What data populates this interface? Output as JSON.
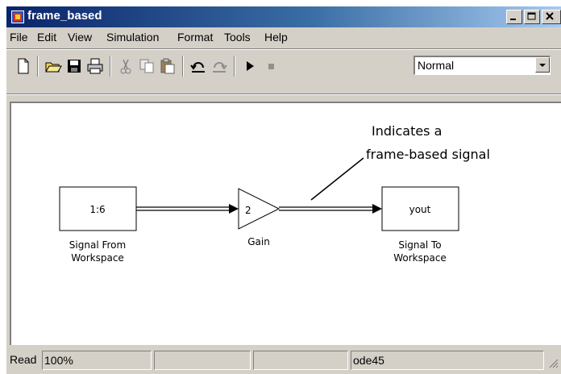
{
  "window": {
    "title": "frame_based"
  },
  "menu": [
    "File",
    "Edit",
    "View",
    "Simulation",
    "Format",
    "Tools",
    "Help"
  ],
  "toolbar": {
    "icons": [
      "new-file-icon",
      "open-folder-icon",
      "save-icon",
      "print-icon",
      "cut-icon",
      "copy-icon",
      "paste-icon",
      "undo-icon",
      "redo-icon",
      "start-simulation-icon",
      "stop-simulation-icon"
    ],
    "sim_mode": "Normal"
  },
  "diagram": {
    "source_block": {
      "value": "1:6",
      "label_line1": "Signal From",
      "label_line2": "Workspace"
    },
    "gain_block": {
      "value": "2",
      "label": "Gain"
    },
    "sink_block": {
      "value": "yout",
      "label_line1": "Signal To",
      "label_line2": "Workspace"
    },
    "annotation_line1": "Indicates a",
    "annotation_line2": "frame-based signal"
  },
  "status": {
    "ready": "Read",
    "zoom": "100%",
    "solver": "ode45"
  }
}
